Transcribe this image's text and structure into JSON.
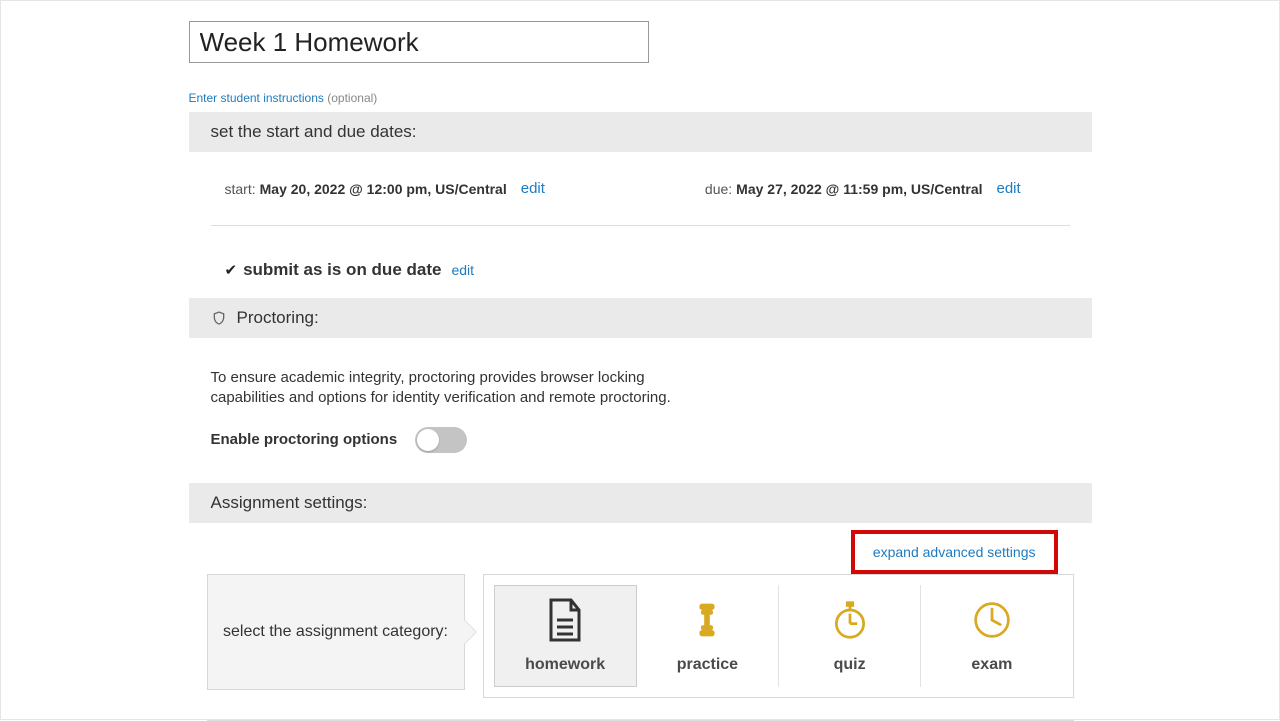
{
  "title": {
    "value": "Week 1 Homework"
  },
  "instructions": {
    "link": "Enter student instructions",
    "optional": "(optional)"
  },
  "dates_header": "set the start and due dates:",
  "start": {
    "label": "start: ",
    "value": "May 20, 2022 @ 12:00 pm, US/Central"
  },
  "due": {
    "label": "due: ",
    "value": "May 27, 2022 @ 11:59 pm, US/Central"
  },
  "edit": "edit",
  "submit": {
    "text": "submit as is on due date"
  },
  "proctoring": {
    "header": "Proctoring:",
    "desc": "To ensure academic integrity, proctoring provides browser locking capabilities and options for identity verification and remote proctoring.",
    "toggle_label": "Enable proctoring options",
    "enabled": false
  },
  "assignment_settings_header": "Assignment settings:",
  "advanced_link": "expand advanced settings",
  "category": {
    "label": "select the assignment category:",
    "options": [
      "homework",
      "practice",
      "quiz",
      "exam"
    ],
    "selected": "homework"
  }
}
